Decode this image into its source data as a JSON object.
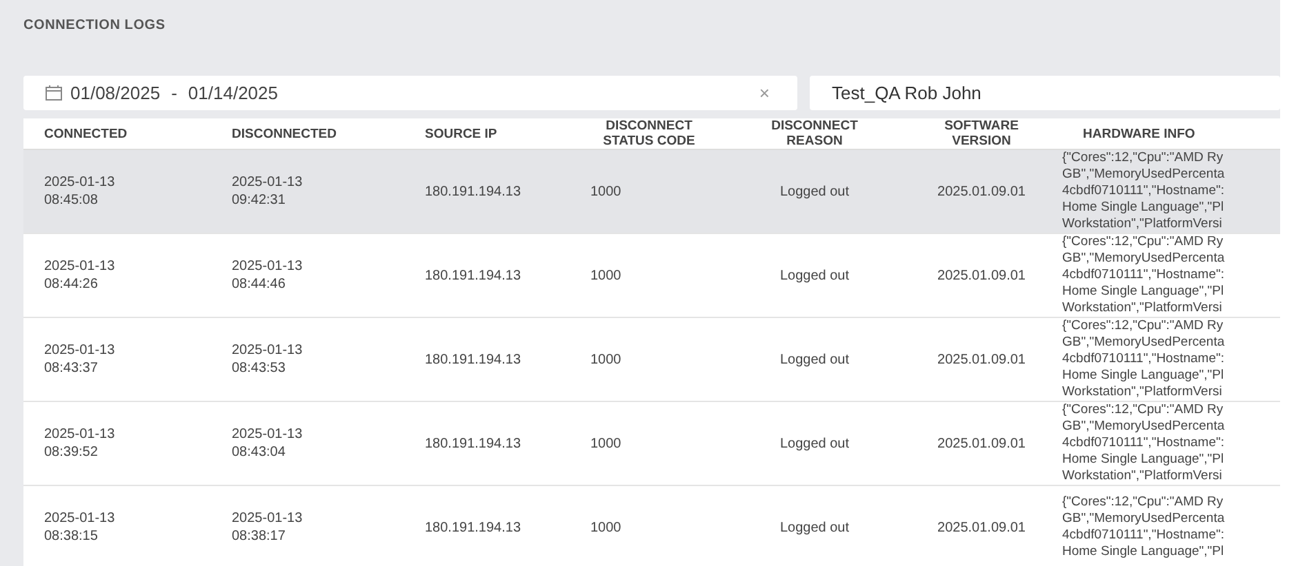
{
  "page_title": "CONNECTION LOGS",
  "date_range": {
    "start": "01/08/2025",
    "separator": "-",
    "end": "01/14/2025",
    "clear": "×"
  },
  "search": {
    "value": "Test_QA Rob John"
  },
  "table": {
    "columns": [
      [
        "CONNECTED"
      ],
      [
        "DISCONNECTED"
      ],
      [
        "SOURCE IP"
      ],
      [
        "DISCONNECT",
        "STATUS CODE"
      ],
      [
        "DISCONNECT",
        "REASON"
      ],
      [
        "SOFTWARE",
        "VERSION"
      ],
      [
        "HARDWARE INFO"
      ]
    ],
    "rows": [
      {
        "selected": true,
        "connected": [
          "2025-01-13",
          "08:45:08"
        ],
        "disconnected": [
          "2025-01-13",
          "09:42:31"
        ],
        "source_ip": "180.191.194.13",
        "status_code": "1000",
        "reason": "Logged out",
        "software_version": "2025.01.09.01",
        "hardware_info": [
          "{\"Cores\":12,\"Cpu\":\"AMD Ry",
          "GB\",\"MemoryUsedPercenta",
          "4cbdf0710111\",\"Hostname\":",
          "Home Single Language\",\"Pl",
          "Workstation\",\"PlatformVersi"
        ]
      },
      {
        "selected": false,
        "connected": [
          "2025-01-13",
          "08:44:26"
        ],
        "disconnected": [
          "2025-01-13",
          "08:44:46"
        ],
        "source_ip": "180.191.194.13",
        "status_code": "1000",
        "reason": "Logged out",
        "software_version": "2025.01.09.01",
        "hardware_info": [
          "{\"Cores\":12,\"Cpu\":\"AMD Ry",
          "GB\",\"MemoryUsedPercenta",
          "4cbdf0710111\",\"Hostname\":",
          "Home Single Language\",\"Pl",
          "Workstation\",\"PlatformVersi"
        ]
      },
      {
        "selected": false,
        "connected": [
          "2025-01-13",
          "08:43:37"
        ],
        "disconnected": [
          "2025-01-13",
          "08:43:53"
        ],
        "source_ip": "180.191.194.13",
        "status_code": "1000",
        "reason": "Logged out",
        "software_version": "2025.01.09.01",
        "hardware_info": [
          "{\"Cores\":12,\"Cpu\":\"AMD Ry",
          "GB\",\"MemoryUsedPercenta",
          "4cbdf0710111\",\"Hostname\":",
          "Home Single Language\",\"Pl",
          "Workstation\",\"PlatformVersi"
        ]
      },
      {
        "selected": false,
        "connected": [
          "2025-01-13",
          "08:39:52"
        ],
        "disconnected": [
          "2025-01-13",
          "08:43:04"
        ],
        "source_ip": "180.191.194.13",
        "status_code": "1000",
        "reason": "Logged out",
        "software_version": "2025.01.09.01",
        "hardware_info": [
          "{\"Cores\":12,\"Cpu\":\"AMD Ry",
          "GB\",\"MemoryUsedPercenta",
          "4cbdf0710111\",\"Hostname\":",
          "Home Single Language\",\"Pl",
          "Workstation\",\"PlatformVersi"
        ]
      },
      {
        "selected": false,
        "connected": [
          "2025-01-13",
          "08:38:15"
        ],
        "disconnected": [
          "2025-01-13",
          "08:38:17"
        ],
        "source_ip": "180.191.194.13",
        "status_code": "1000",
        "reason": "Logged out",
        "software_version": "2025.01.09.01",
        "hardware_info": [
          "{\"Cores\":12,\"Cpu\":\"AMD Ry",
          "GB\",\"MemoryUsedPercenta",
          "4cbdf0710111\",\"Hostname\":",
          "Home Single Language\",\"Pl"
        ]
      }
    ]
  }
}
